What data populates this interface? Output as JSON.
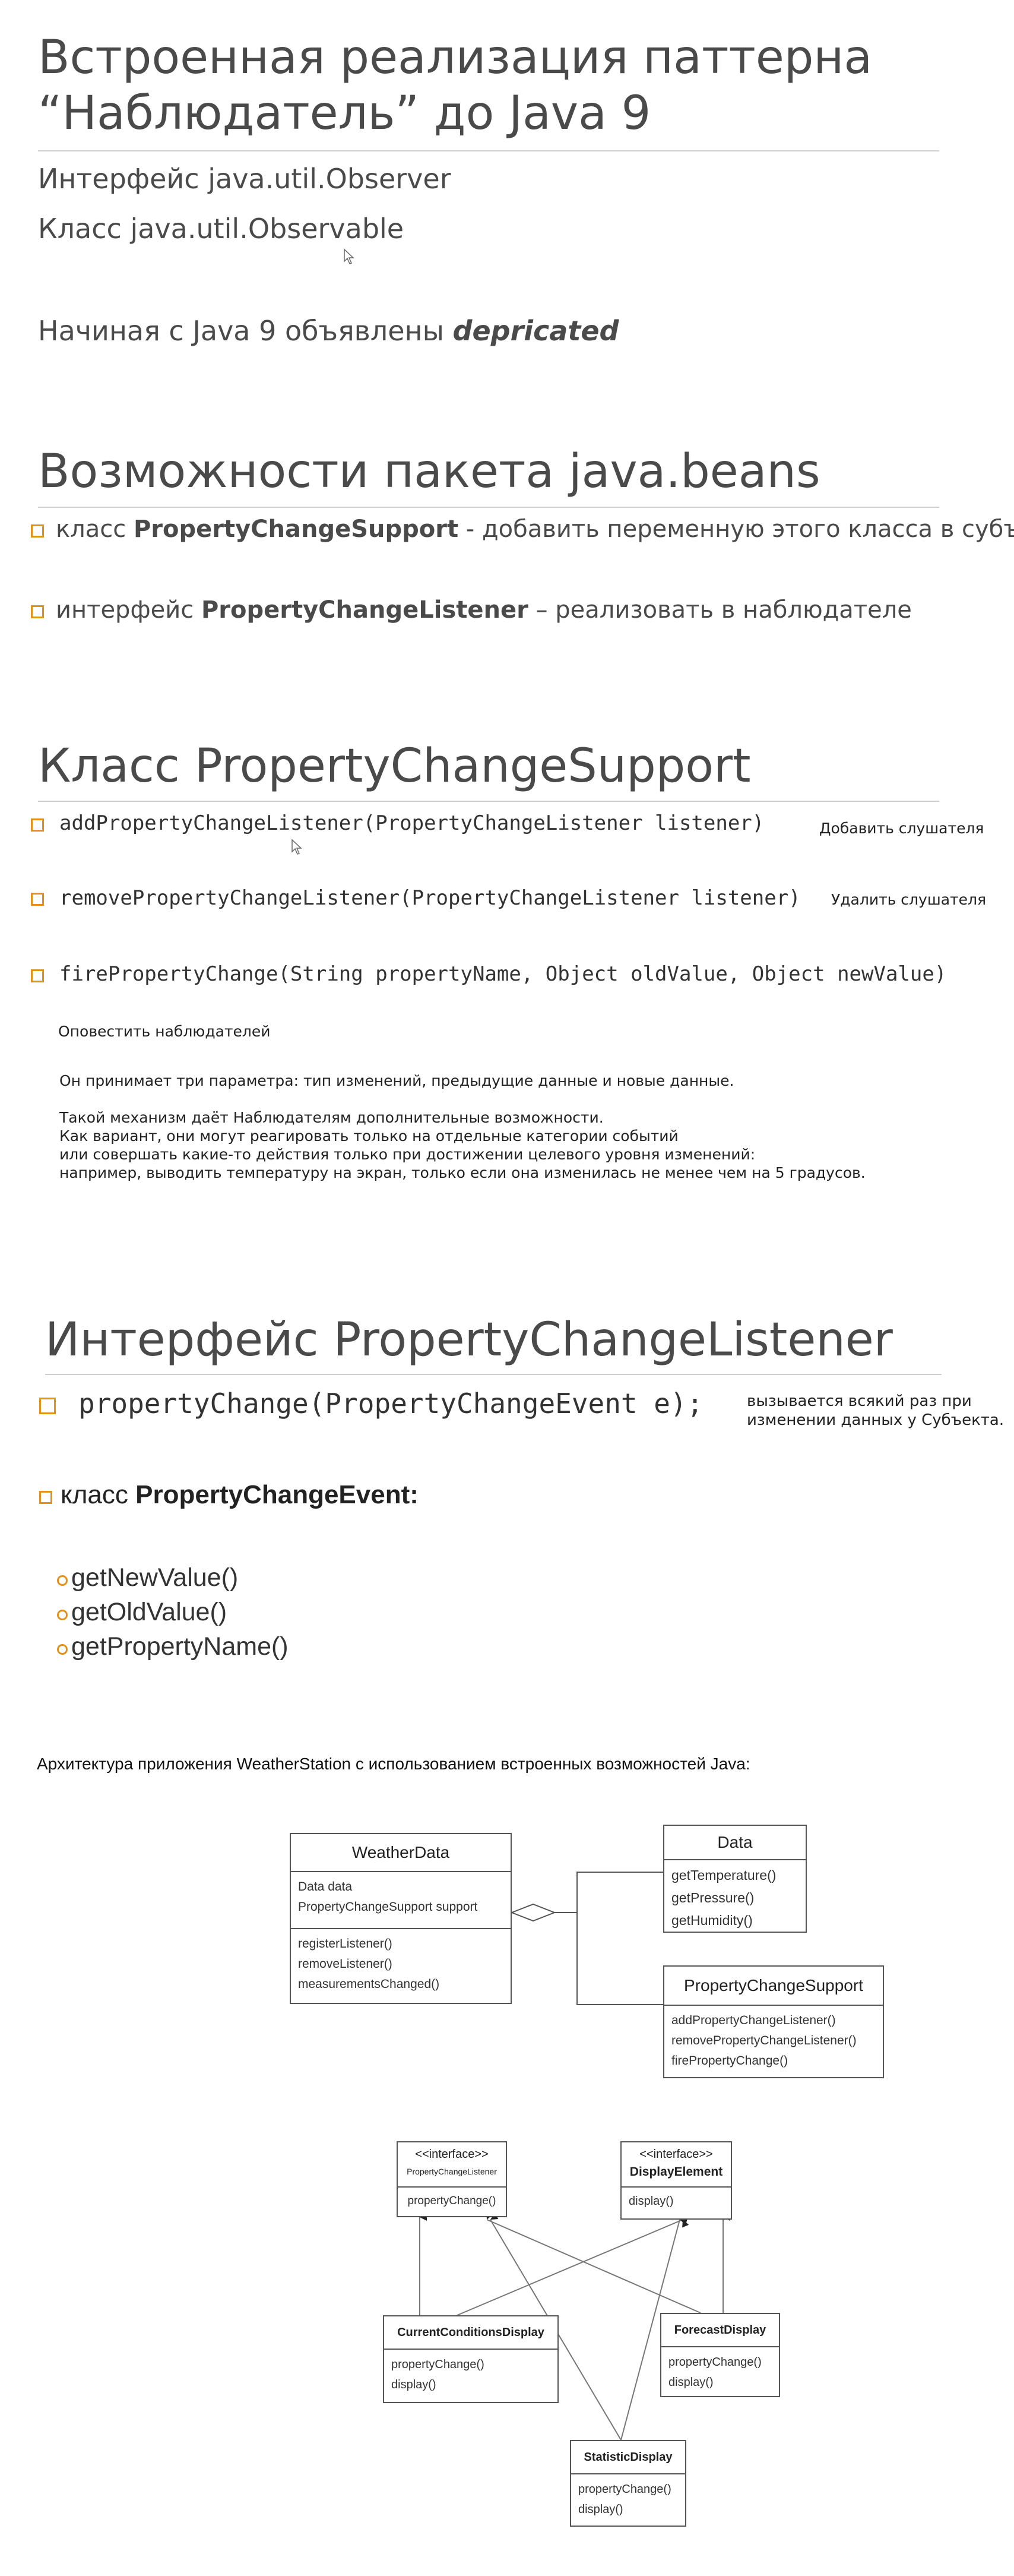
{
  "section1": {
    "title_line1": "Встроенная реализация паттерна",
    "title_line2": "“Наблюдатель” до Java 9",
    "line1": "Интерфейс java.util.Observer",
    "line2": "Класс java.util.Observable",
    "line3_prefix": "Начиная с Java 9 объявлены ",
    "line3_emph": "depricated"
  },
  "section2": {
    "title": "Возможности пакета java.beans",
    "item1_prefix": "класс ",
    "item1_bold": "PropertyChangeSupport",
    "item1_suffix": "   - добавить  переменную этого класса в субъект",
    "item2_prefix": "интерфейс ",
    "item2_bold": "PropertyChangeListener",
    "item2_suffix": " – реализовать в наблюдателе"
  },
  "section3": {
    "title": "Класс PropertyChangeSupport",
    "m1": "addPropertyChangeListener(PropertyChangeListener listener)",
    "m1_note": "Добавить слушателя",
    "m2": "removePropertyChangeListener(PropertyChangeListener listener)",
    "m2_note": "Удалить слушателя",
    "m3": "firePropertyChange(String propertyName, Object oldValue, Object newValue)",
    "m3_note": "Оповестить наблюдателей",
    "p1": "Он принимает три параметра: тип изменений, предыдущие данные и новые данные.",
    "p2": "Такой механизм даёт Наблюдателям дополнительные возможности.",
    "p3": "Как вариант, они могут реагировать только на отдельные категории событий",
    "p4": "или совершать какие-то действия только при достижении целевого уровня изменений:",
    "p5": "например, выводить температуру на экран, только если она изменилась не менее чем на 5 градусов."
  },
  "section4": {
    "title": "Интерфейс PropertyChangeListener",
    "method": "propertyChange(PropertyChangeEvent e);",
    "note1": "вызывается всякий раз при",
    "note2": "изменении данных у Субъекта.",
    "event_prefix": "класс ",
    "event_bold": "PropertyChangeEvent:",
    "getters": [
      "getNewValue()",
      "getOldValue()",
      "getPropertyName()"
    ]
  },
  "section5": {
    "caption": "Архитектура приложения WeatherStation с использованием встроенных возможностей Java:",
    "weatherdata": {
      "name": "WeatherData",
      "fields": [
        "Data data",
        "PropertyChangeSupport support"
      ],
      "methods": [
        "registerListener()",
        "removeListener()",
        "measurementsChanged()"
      ]
    },
    "data": {
      "name": "Data",
      "methods": [
        "getTemperature()",
        "getPressure()",
        "getHumidity()"
      ]
    },
    "pcs": {
      "name": "PropertyChangeSupport",
      "methods": [
        "addPropertyChangeListener()",
        "removePropertyChangeListener()",
        "firePropertyChange()"
      ]
    },
    "pcl": {
      "stereo": "<<interface>>",
      "name": "PropertyChangeListener",
      "methods": [
        "propertyChange()"
      ]
    },
    "de": {
      "stereo": "<<interface>>",
      "name": "DisplayElement",
      "methods": [
        "display()"
      ]
    },
    "ccd": {
      "name": "CurrentConditionsDisplay",
      "methods": [
        "propertyChange()",
        "display()"
      ]
    },
    "fd": {
      "name": "ForecastDisplay",
      "methods": [
        "propertyChange()",
        "display()"
      ]
    },
    "sd": {
      "name": "StatisticDisplay",
      "methods": [
        "propertyChange()",
        "display()"
      ]
    }
  }
}
